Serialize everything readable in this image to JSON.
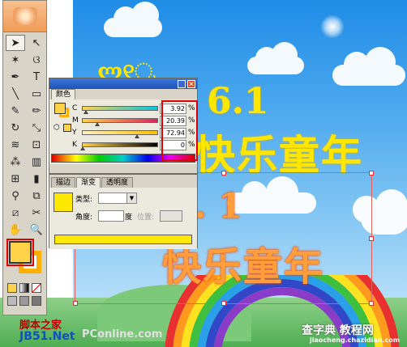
{
  "toolbox": {
    "tools": [
      {
        "name": "selection-tool",
        "glyph": "➤"
      },
      {
        "name": "direct-selection-tool",
        "glyph": "↖"
      },
      {
        "name": "magic-wand-tool",
        "glyph": "✶"
      },
      {
        "name": "lasso-tool",
        "glyph": "ଓ"
      },
      {
        "name": "pen-tool",
        "glyph": "✒"
      },
      {
        "name": "type-tool",
        "glyph": "T"
      },
      {
        "name": "line-tool",
        "glyph": "╲"
      },
      {
        "name": "rectangle-tool",
        "glyph": "▭"
      },
      {
        "name": "paintbrush-tool",
        "glyph": "✎"
      },
      {
        "name": "pencil-tool",
        "glyph": "✏"
      },
      {
        "name": "rotate-tool",
        "glyph": "↻"
      },
      {
        "name": "scale-tool",
        "glyph": "⤡"
      },
      {
        "name": "warp-tool",
        "glyph": "≋"
      },
      {
        "name": "free-transform-tool",
        "glyph": "⊡"
      },
      {
        "name": "symbol-sprayer-tool",
        "glyph": "⁂"
      },
      {
        "name": "graph-tool",
        "glyph": "▥"
      },
      {
        "name": "mesh-tool",
        "glyph": "⊞"
      },
      {
        "name": "gradient-tool",
        "glyph": "▮"
      },
      {
        "name": "eyedropper-tool",
        "glyph": "⚲"
      },
      {
        "name": "blend-tool",
        "glyph": "⧉"
      },
      {
        "name": "slice-tool",
        "glyph": "⧄"
      },
      {
        "name": "scissors-tool",
        "glyph": "✂"
      },
      {
        "name": "hand-tool",
        "glyph": "✋"
      },
      {
        "name": "zoom-tool",
        "glyph": "🔍"
      }
    ]
  },
  "color_panel": {
    "tab_label": "颜色",
    "channels": [
      {
        "label": "C",
        "value": "3.92",
        "unit": "%"
      },
      {
        "label": "M",
        "value": "20.39",
        "unit": "%"
      },
      {
        "label": "Y",
        "value": "72.94",
        "unit": "%"
      },
      {
        "label": "K",
        "value": "0",
        "unit": "%"
      }
    ],
    "thumb_positions": [
      0.04,
      0.2,
      0.73,
      0.0
    ]
  },
  "gradient_panel": {
    "tabs": [
      "描边",
      "渐变",
      "透明度"
    ],
    "type_label": "类型:",
    "angle_label": "角度:",
    "angle_unit": "度",
    "position_label": "位置:"
  },
  "artwork": {
    "date_top": "6.1",
    "date_bottom": ". 1",
    "title_top": "快乐童年",
    "title_bottom": "快乐童年"
  },
  "watermarks": {
    "left_top": "脚本之家",
    "left_bottom": "JB51.Net",
    "middle": "PConline.com",
    "right_top": "查字典 教程网",
    "right_bottom": "jiaocheng.chazidian.com"
  },
  "colors": {
    "fill": "#ffd24a",
    "gradient_yellow": "#ffe800",
    "highlight_red": "#e00000"
  }
}
